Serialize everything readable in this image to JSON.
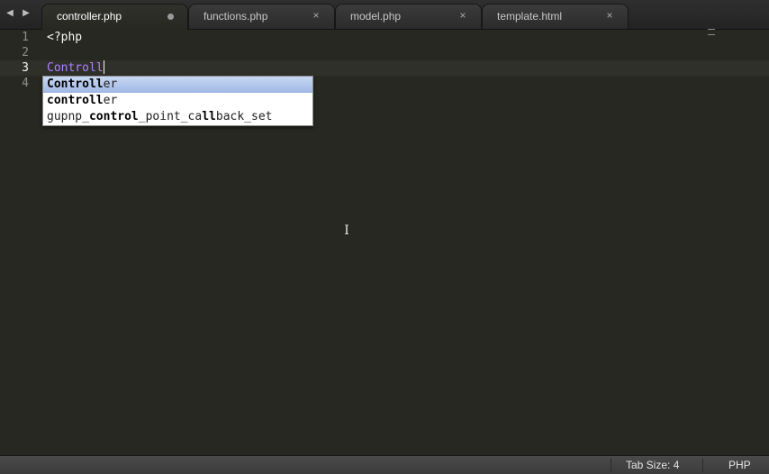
{
  "tabs": [
    {
      "label": "controller.php",
      "active": true,
      "dirty": true
    },
    {
      "label": "functions.php",
      "close_icon": "×"
    },
    {
      "label": "model.php",
      "close_icon": "×"
    },
    {
      "label": "template.html",
      "close_icon": "×"
    }
  ],
  "nav": {
    "back_icon": "◀",
    "forward_icon": "▶"
  },
  "editor": {
    "line_numbers": [
      "1",
      "2",
      "3",
      "4"
    ],
    "current_line": "3",
    "lines": {
      "l1": "<?php",
      "l2": "",
      "l3_typed": "Controll",
      "l4": ""
    }
  },
  "autocomplete": {
    "items": [
      {
        "segments": [
          {
            "text": "Controll",
            "bold": true
          },
          {
            "text": "er",
            "bold": false
          }
        ]
      },
      {
        "segments": [
          {
            "text": "controll",
            "bold": true
          },
          {
            "text": "er",
            "bold": false
          }
        ]
      },
      {
        "segments": [
          {
            "text": "gupnp_",
            "bold": false
          },
          {
            "text": "control",
            "bold": true
          },
          {
            "text": "_point_ca",
            "bold": false
          },
          {
            "text": "ll",
            "bold": true
          },
          {
            "text": "back_set",
            "bold": false
          }
        ]
      }
    ]
  },
  "cursor": {
    "glyph": "I",
    "icon": "text-cursor-icon"
  },
  "status": {
    "tab_size": "Tab Size: 4",
    "syntax": "PHP"
  },
  "colors": {
    "background": "#272822",
    "typed_text": "#ae81ff",
    "selection": "#9fb7e4"
  }
}
